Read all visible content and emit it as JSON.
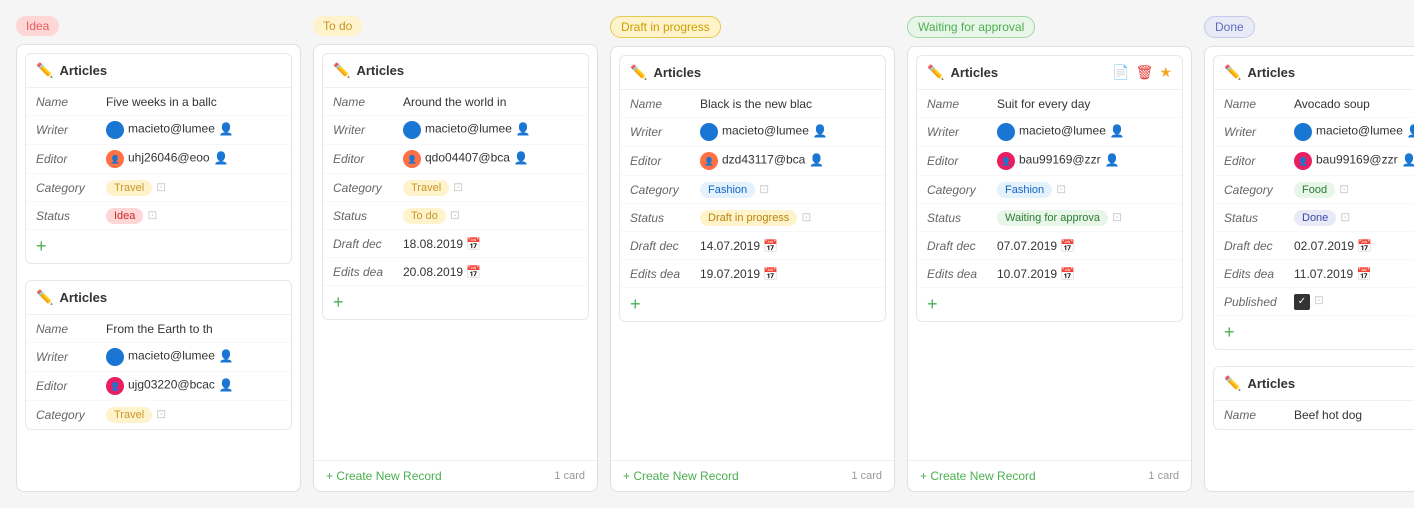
{
  "columns": [
    {
      "id": "idea",
      "badge_label": "Idea",
      "badge_class": "badge-idea",
      "cards": [
        {
          "title": "Articles",
          "rows": [
            {
              "label": "Name",
              "value": "Five weeks in a ballc",
              "type": "text"
            },
            {
              "label": "Writer",
              "value": "macieto@lumee",
              "type": "avatar",
              "avatar_class": "avatar-blue"
            },
            {
              "label": "Editor",
              "value": "uhj26046@eoo",
              "type": "avatar",
              "avatar_class": "avatar-orange"
            },
            {
              "label": "Category",
              "value": "Travel",
              "type": "tag",
              "tag_class": "tag-travel"
            },
            {
              "label": "Status",
              "value": "Idea",
              "type": "tag",
              "tag_class": "tag-idea"
            }
          ],
          "add": true
        },
        {
          "title": "Articles",
          "rows": [
            {
              "label": "Name",
              "value": "From the Earth to th",
              "type": "text"
            },
            {
              "label": "Writer",
              "value": "macieto@lumee",
              "type": "avatar",
              "avatar_class": "avatar-blue"
            },
            {
              "label": "Editor",
              "value": "ujg03220@bcac",
              "type": "avatar",
              "avatar_class": "avatar-pink"
            },
            {
              "label": "Category",
              "value": "Travel",
              "type": "tag",
              "tag_class": "tag-travel"
            }
          ],
          "add": false
        }
      ],
      "footer": null
    },
    {
      "id": "todo",
      "badge_label": "To do",
      "badge_class": "badge-todo",
      "cards": [
        {
          "title": "Articles",
          "rows": [
            {
              "label": "Name",
              "value": "Around the world in",
              "type": "text"
            },
            {
              "label": "Writer",
              "value": "macieto@lumee",
              "type": "avatar",
              "avatar_class": "avatar-blue"
            },
            {
              "label": "Editor",
              "value": "qdo04407@bca",
              "type": "avatar",
              "avatar_class": "avatar-orange"
            },
            {
              "label": "Category",
              "value": "Travel",
              "type": "tag",
              "tag_class": "tag-travel"
            },
            {
              "label": "Status",
              "value": "To do",
              "type": "tag",
              "tag_class": "tag-todo"
            },
            {
              "label": "Draft dec",
              "value": "18.08.2019",
              "type": "date"
            },
            {
              "label": "Edits dea",
              "value": "20.08.2019",
              "type": "date"
            }
          ],
          "add": true
        }
      ],
      "footer": {
        "create_label": "Create New Record",
        "count": "1 card"
      }
    },
    {
      "id": "draft",
      "badge_label": "Draft in progress",
      "badge_class": "badge-draft",
      "cards": [
        {
          "title": "Articles",
          "rows": [
            {
              "label": "Name",
              "value": "Black is the new blac",
              "type": "text"
            },
            {
              "label": "Writer",
              "value": "macieto@lumee",
              "type": "avatar",
              "avatar_class": "avatar-blue"
            },
            {
              "label": "Editor",
              "value": "dzd43117@bca",
              "type": "avatar",
              "avatar_class": "avatar-orange"
            },
            {
              "label": "Category",
              "value": "Fashion",
              "type": "tag",
              "tag_class": "tag-fashion"
            },
            {
              "label": "Status",
              "value": "Draft in progress",
              "type": "tag",
              "tag_class": "tag-draft"
            },
            {
              "label": "Draft dec",
              "value": "14.07.2019",
              "type": "date"
            },
            {
              "label": "Edits dea",
              "value": "19.07.2019",
              "type": "date"
            }
          ],
          "add": true
        }
      ],
      "footer": {
        "create_label": "Create New Record",
        "count": "1 card"
      }
    },
    {
      "id": "waiting",
      "badge_label": "Waiting for approval",
      "badge_class": "badge-waiting",
      "cards": [
        {
          "title": "Articles",
          "has_actions": true,
          "rows": [
            {
              "label": "Name",
              "value": "Suit for every day",
              "type": "text"
            },
            {
              "label": "Writer",
              "value": "macieto@lumee",
              "type": "avatar",
              "avatar_class": "avatar-blue"
            },
            {
              "label": "Editor",
              "value": "bau99169@zzr",
              "type": "avatar",
              "avatar_class": "avatar-pink"
            },
            {
              "label": "Category",
              "value": "Fashion",
              "type": "tag",
              "tag_class": "tag-fashion"
            },
            {
              "label": "Status",
              "value": "Waiting for approva",
              "type": "tag",
              "tag_class": "tag-waiting"
            },
            {
              "label": "Draft dec",
              "value": "07.07.2019",
              "type": "date"
            },
            {
              "label": "Edits dea",
              "value": "10.07.2019",
              "type": "date"
            }
          ],
          "add": true
        }
      ],
      "footer": {
        "create_label": "Create New Record",
        "count": "1 card"
      }
    },
    {
      "id": "done",
      "badge_label": "Done",
      "badge_class": "badge-done",
      "cards": [
        {
          "title": "Articles",
          "rows": [
            {
              "label": "Name",
              "value": "Avocado soup",
              "type": "text"
            },
            {
              "label": "Writer",
              "value": "macieto@lumee",
              "type": "avatar",
              "avatar_class": "avatar-blue"
            },
            {
              "label": "Editor",
              "value": "bau99169@zzr",
              "type": "avatar",
              "avatar_class": "avatar-pink"
            },
            {
              "label": "Category",
              "value": "Food",
              "type": "tag",
              "tag_class": "tag-food"
            },
            {
              "label": "Status",
              "value": "Done",
              "type": "tag",
              "tag_class": "tag-done"
            },
            {
              "label": "Draft dec",
              "value": "02.07.2019",
              "type": "date"
            },
            {
              "label": "Edits dea",
              "value": "11.07.2019",
              "type": "date"
            },
            {
              "label": "Published",
              "value": "",
              "type": "checkbox"
            }
          ],
          "add": true
        },
        {
          "title": "Articles",
          "rows": [
            {
              "label": "Name",
              "value": "Beef hot dog",
              "type": "text"
            }
          ],
          "add": false
        }
      ],
      "footer": null
    }
  ],
  "labels": {
    "create_new": "+ Create New Record",
    "add_icon": "+",
    "card_title_icon": "✏️"
  }
}
